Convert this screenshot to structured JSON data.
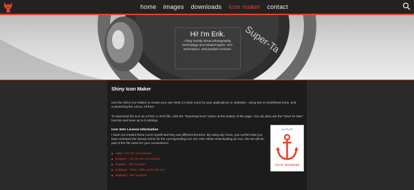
{
  "header": {
    "nav": [
      {
        "label": "home",
        "active": false
      },
      {
        "label": "images",
        "active": false
      },
      {
        "label": "downloads",
        "active": false
      },
      {
        "label": "icon maker",
        "active": true
      },
      {
        "label": "contact",
        "active": false
      }
    ],
    "icons": {
      "logo": "fox-logo-icon",
      "search": "search-icon"
    },
    "accent_color": "#e5432a"
  },
  "hero": {
    "title": "Hi! I'm Erik.",
    "subtitle": "I blog mostly about photography, technology and related topics. DIY, techniques, and product reviews.",
    "lens_text": "Super-Ta"
  },
  "content": {
    "heading": "Shiny Icon Maker",
    "intro": "Use the Shiny Icon Maker to create your own Web 2.0 style icons for your applications or websites - using text or predefined icons, and customizing the colors. All free!",
    "download_info": "To download the icon as a PNG or SVG file, click the \"Download Icon\" button at the bottom of the page. You can also use the \"Save for later\" function and save up to 5 settings.",
    "license_heading": "Icon Sets License Information",
    "license_text": "I have not created these icons myself and they use different licenses. By using any icons, you confirm that you have reviewed the license terms for the corresponding icon set. Hint: When downloading an icon, the set will be part of the file name for your convenience.",
    "licenses": [
      "Allan - CC BY 4.0 License",
      "Entypo+ - CC BY-SA 4.0 License",
      "Feather - MIT License",
      "IcoMoon - Free - GPL or CC BY 4.0",
      "Raphael - MIT License"
    ]
  },
  "preview": {
    "title": "Anchor2",
    "icon": "anchor-icon",
    "link": "Go to download"
  }
}
